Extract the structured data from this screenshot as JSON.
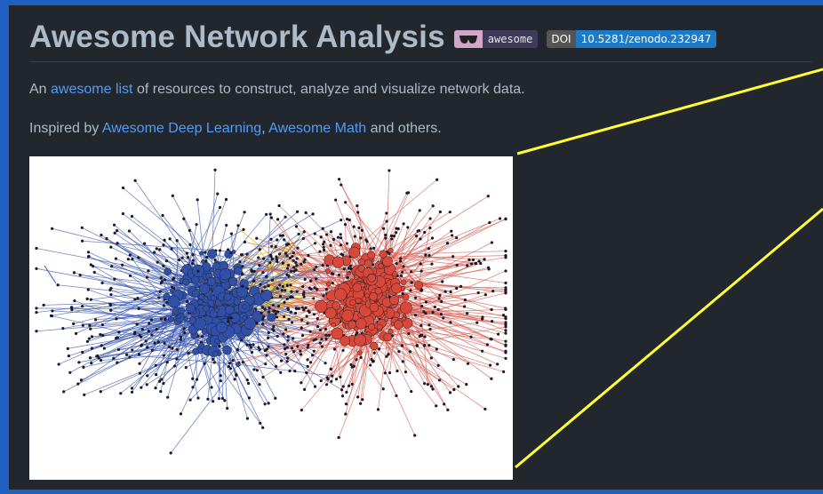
{
  "header": {
    "title": "Awesome Network Analysis",
    "badge_awesome": {
      "icon": "glasses-icon",
      "label": "awesome",
      "icon_color": "#d2a6c9",
      "label_bg": "#3f3a59"
    },
    "badge_doi": {
      "prefix": "DOI",
      "value": "10.5281/zenodo.232947",
      "value_bg": "#1f7ac6"
    }
  },
  "intro": {
    "before": "An ",
    "link": "awesome list",
    "after": " of resources to construct, analyze and visualize network data."
  },
  "inspired": {
    "before": "Inspired by ",
    "link1": "Awesome Deep Learning",
    "sep": ", ",
    "link2": "Awesome Math",
    "after": " and others."
  },
  "colors": {
    "background": "#22272e",
    "text": "#adbac7",
    "link": "#539bf5",
    "callout": "#ffff33",
    "cluster_left": "#2f4fa8",
    "cluster_right": "#d9463a",
    "bridge": "#f0c020"
  }
}
